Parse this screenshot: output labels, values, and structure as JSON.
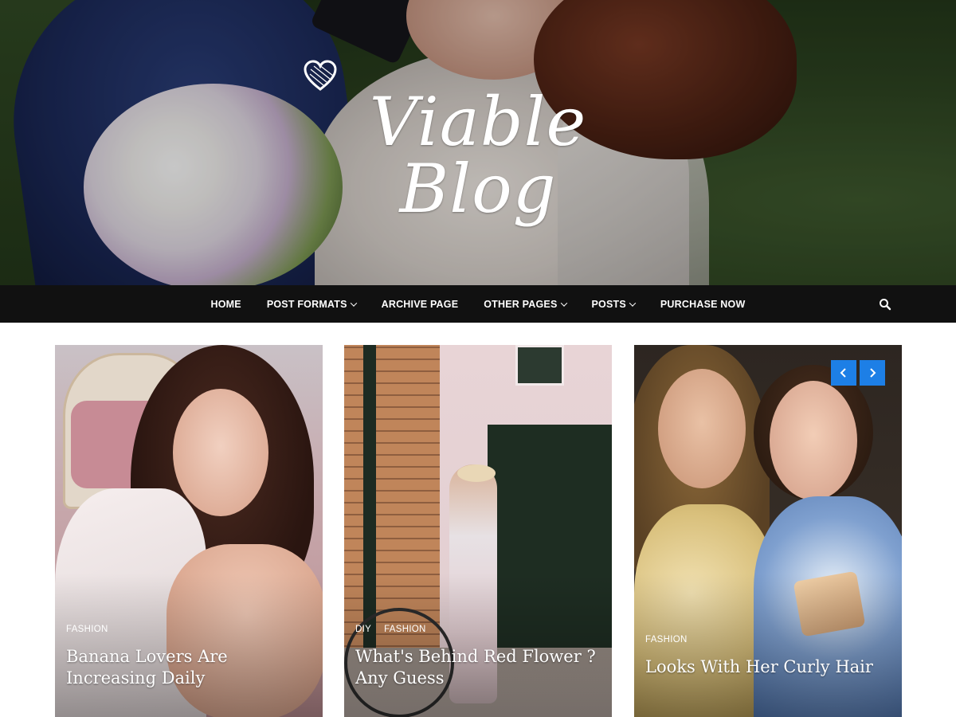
{
  "site": {
    "logo_text": "Viable Blog"
  },
  "nav": {
    "items": [
      {
        "label": "HOME",
        "has_dropdown": false
      },
      {
        "label": "POST FORMATS",
        "has_dropdown": true
      },
      {
        "label": "ARCHIVE PAGE",
        "has_dropdown": false
      },
      {
        "label": "OTHER PAGES",
        "has_dropdown": true
      },
      {
        "label": "POSTS",
        "has_dropdown": true
      },
      {
        "label": "PURCHASE NOW",
        "has_dropdown": false
      }
    ],
    "search_icon": "search-icon"
  },
  "posts": [
    {
      "categories": [
        "FASHION"
      ],
      "title": "Banana Lovers Are Increasing Daily"
    },
    {
      "categories": [
        "DIY",
        "FASHION"
      ],
      "title": "What's Behind Red Flower ? Any Guess"
    },
    {
      "categories": [
        "FASHION"
      ],
      "title": "Looks With Her Curly Hair"
    }
  ],
  "slider": {
    "prev_icon": "chevron-left-icon",
    "next_icon": "chevron-right-icon"
  },
  "colors": {
    "nav_bg": "#111111",
    "accent": "#1d7fe6",
    "text_light": "#ffffff"
  }
}
